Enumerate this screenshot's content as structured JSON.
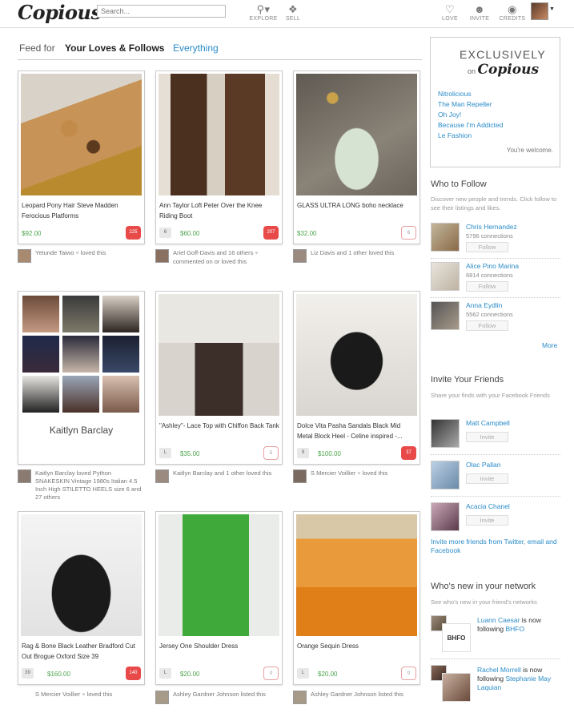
{
  "header": {
    "logo": "Copious",
    "search_placeholder": "Search...",
    "nav": [
      {
        "label": "EXPLORE",
        "icon": "magnifier-icon"
      },
      {
        "label": "SELL",
        "icon": "tag-icon"
      },
      {
        "label": "LOVE",
        "icon": "heart-icon"
      },
      {
        "label": "INVITE",
        "icon": "people-icon"
      },
      {
        "label": "CREDITS",
        "icon": "coins-icon"
      }
    ]
  },
  "feed": {
    "for_label": "Feed for",
    "tab_active": "Your Loves & Follows",
    "tab_other": "Everything"
  },
  "cards": [
    {
      "title": "Leopard Pony Hair Steve Madden Ferocious Platforms",
      "price": "$92.00",
      "loves": "225",
      "loved": true,
      "byline": "Yetunde Taiwo",
      "byline_tail": " loved this"
    },
    {
      "title": "Ann Taylor Loft Peter Over the Knee Riding Boot",
      "cond": "6",
      "price": "$60.00",
      "loves": "207",
      "loved": true,
      "byline": "Ariel Goff-Davis and 16 others",
      "byline_tail": " commented on or loved this"
    },
    {
      "title": "GLASS ULTRA LONG boho necklace",
      "price": "$32.00",
      "loves": "6",
      "loved": false,
      "byline": "Liz Davis and 1 other loved this"
    },
    {
      "title": "Kaitlyn Barclay",
      "byline": "Kaitlyn Barclay loved Python SNAKESKIN Vintage 1980s Italian 4.5 Inch High STILETTO HEELS size 6 and 27 others"
    },
    {
      "title": "\"Ashley\"- Lace Top with Chiffon Back Tank",
      "cond": "L",
      "price": "$35.00",
      "loves": "5",
      "loved": false,
      "byline": "Kaitlyn Barclay and 1 other loved this"
    },
    {
      "title": "Dolce Vita Pasha Sandals Black Mid Metal Block Heel - Celine inspired -...",
      "cond": "9",
      "price": "$100.00",
      "loves": "37",
      "loved": true,
      "byline": "S Mercier Voillier",
      "byline_tail": " loved this"
    },
    {
      "title": "Rag & Bone Black Leather Bradford Cut Out Brogue Oxford Size 39",
      "cond": "39",
      "price": "$160.00",
      "loves": "140",
      "loved": true,
      "byline": "S Mercier Voillier",
      "byline_tail": " loved this"
    },
    {
      "title": "Jersey One Shoulder Dress",
      "cond": "L",
      "price": "$20.00",
      "loves": "0",
      "loved": false,
      "byline": "Ashley Gardner Johnson listed this"
    },
    {
      "title": "Orange Sequin Dress",
      "cond": "L",
      "price": "$20.00",
      "loves": "0",
      "loved": false,
      "byline": "Ashley Gardner Johnson listed this"
    }
  ],
  "sidebar": {
    "exclusive_title": "EXCLUSIVELY",
    "exclusive_on": "on",
    "exclusive_brand": "Copious",
    "exclusive_links": [
      "Nitrolicious",
      "The Man Repeller",
      "Oh Joy!",
      "Because I'm Addicted",
      "Le Fashion"
    ],
    "exclusive_foot": "You're welcome.",
    "who_title": "Who to Follow",
    "who_sub": "Discover new people and trends. Click follow to see their listings and likes.",
    "who": [
      {
        "name": "Chris Hernandez",
        "conn": "5796 connections",
        "btn": "Follow"
      },
      {
        "name": "Alice Pino Marina",
        "conn": "6814 connections",
        "btn": "Follow"
      },
      {
        "name": "Anna Eydlin",
        "conn": "5562 connections",
        "btn": "Follow"
      }
    ],
    "more": "More",
    "invite_title": "Invite Your Friends",
    "invite_sub": "Share your finds with your Facebook Friends",
    "invite": [
      {
        "name": "Matt Campbell",
        "btn": "Invite"
      },
      {
        "name": "Olac Pallan",
        "btn": "Invite"
      },
      {
        "name": "Acacia Chanel",
        "btn": "Invite"
      }
    ],
    "invite_more": "Invite more friends from Twitter, email and Facebook",
    "net_title": "Who's new in your network",
    "net_sub": "See who's new in your friend's networks",
    "net": [
      {
        "name": "Luann Caesar",
        "mid": " is now following ",
        "target": "BHFO",
        "badge": "BHFO"
      },
      {
        "name": "Rachel Morrell",
        "mid": " is now following ",
        "target": "Stephanie May Laquian"
      }
    ]
  },
  "colors": {
    "accent": "#2a8bc8",
    "price": "#4da54d",
    "love": "#e84a4a"
  }
}
